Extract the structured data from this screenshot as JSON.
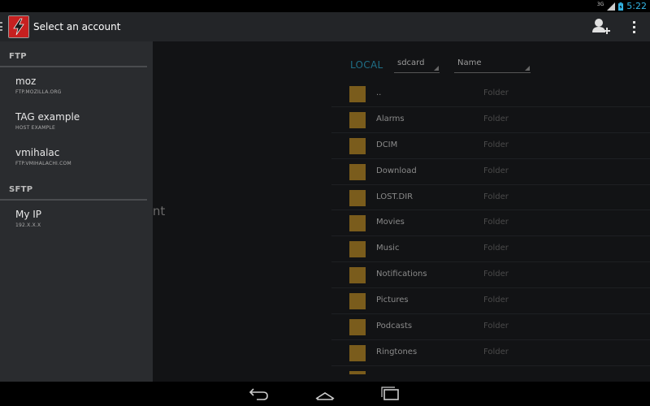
{
  "status_bar": {
    "network": "3G",
    "time": "5:22",
    "accent": "#33b5e5"
  },
  "action_bar": {
    "title": "Select an account",
    "icons": [
      "app-bolt-icon",
      "add-user-icon",
      "overflow-menu-icon"
    ]
  },
  "background": {
    "message_fragment": "an account"
  },
  "file_pane": {
    "local_label": "LOCAL",
    "location_spinner": "sdcard",
    "sort_spinner": "Name",
    "rows": [
      {
        "name": "..",
        "type": "Folder"
      },
      {
        "name": "Alarms",
        "type": "Folder"
      },
      {
        "name": "DCIM",
        "type": "Folder"
      },
      {
        "name": "Download",
        "type": "Folder"
      },
      {
        "name": "LOST.DIR",
        "type": "Folder"
      },
      {
        "name": "Movies",
        "type": "Folder"
      },
      {
        "name": "Music",
        "type": "Folder"
      },
      {
        "name": "Notifications",
        "type": "Folder"
      },
      {
        "name": "Pictures",
        "type": "Folder"
      },
      {
        "name": "Podcasts",
        "type": "Folder"
      },
      {
        "name": "Ringtones",
        "type": "Folder"
      }
    ],
    "folder_color": "#7a5c1c"
  },
  "drawer": {
    "sections": [
      {
        "header": "FTP",
        "accounts": [
          {
            "name": "moz",
            "host": "FTP.MOZILLA.ORG"
          },
          {
            "name": "TAG example",
            "host": "HOST EXAMPLE"
          },
          {
            "name": "vmihalac",
            "host": "FTP.VMIHALACHI.COM"
          }
        ]
      },
      {
        "header": "SFTP",
        "accounts": [
          {
            "name": "My IP",
            "host": "192.X.X.X"
          }
        ]
      }
    ]
  },
  "nav_bar": {
    "icons": [
      "back-icon",
      "home-icon",
      "recent-apps-icon"
    ]
  }
}
